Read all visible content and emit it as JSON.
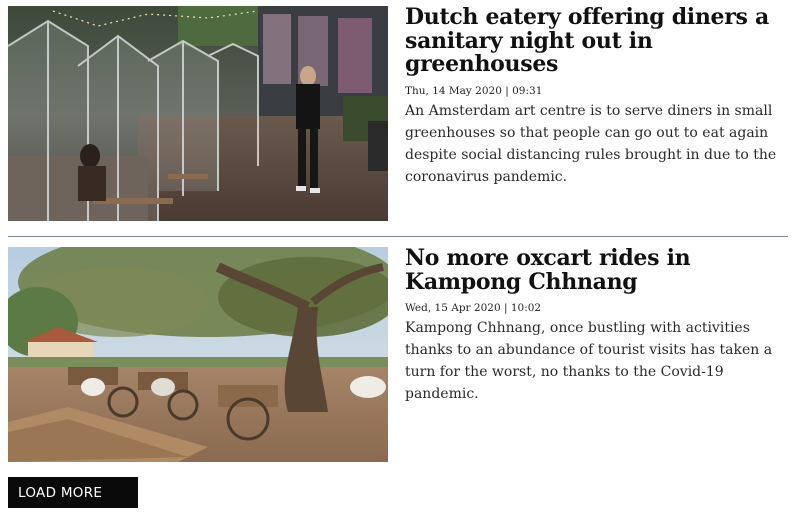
{
  "articles": [
    {
      "headline": "Dutch eatery offering diners a sanitary night out in greenhouses",
      "date": "Thu, 14 May 2020 | 09:31",
      "summary": "An Amsterdam art centre is to serve diners in small greenhouses so that people can go out to eat again despite social distancing rules brought in due to the coronavirus pandemic."
    },
    {
      "headline": "No more oxcart rides in Kampong Chhnang",
      "date": "Wed, 15 Apr 2020 | 10:02",
      "summary": "Kampong Chhnang, once bustling with activities thanks to an abundance of tourist visits has taken a turn for the worst, no thanks to the Covid-19 pandemic."
    }
  ],
  "load_more_label": "LOAD MORE"
}
